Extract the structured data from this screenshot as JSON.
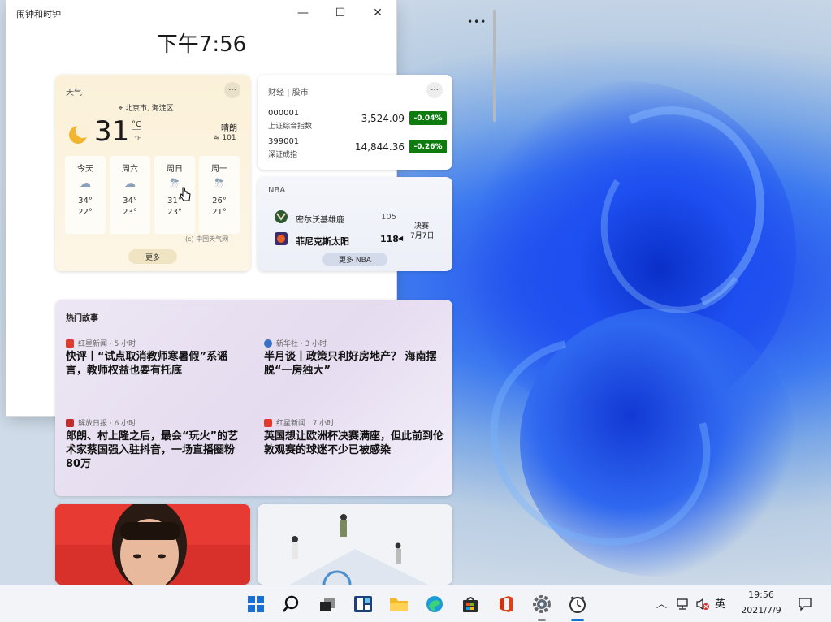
{
  "clock_window": {
    "title": "闹钟和时钟",
    "minimize": "—",
    "maximize": "☐",
    "close": "✕",
    "time": "下午7:56"
  },
  "desktop_more": "•••",
  "weather": {
    "title": "天气",
    "more_dots": "···",
    "location": "北京市, 海淀区",
    "temp": "31",
    "unit_c": "°C",
    "unit_f": "°F",
    "condition": "晴朗",
    "aqi": "101",
    "days": [
      {
        "name": "今天",
        "high": "34°",
        "low": "22°",
        "icon": "cloudy-icon"
      },
      {
        "name": "周六",
        "high": "34°",
        "low": "23°",
        "icon": "cloudy-icon"
      },
      {
        "name": "周日",
        "high": "31°",
        "low": "23°",
        "icon": "thunderstorm-icon"
      },
      {
        "name": "周一",
        "high": "26°",
        "low": "21°",
        "icon": "thunderstorm-icon"
      }
    ],
    "source": "(c) 中国天气网",
    "more": "更多"
  },
  "stocks": {
    "title": "财经 | 股市",
    "more_dots": "···",
    "rows": [
      {
        "code": "000001",
        "name": "上证综合指数",
        "value": "3,524.09",
        "change": "-0.04%"
      },
      {
        "code": "399001",
        "name": "深证成指",
        "value": "14,844.36",
        "change": "-0.26%"
      }
    ],
    "change_color": "#0f7b0f"
  },
  "nba": {
    "title": "NBA",
    "team1": "密尔沃基雄鹿",
    "score1": "105",
    "team2": "菲尼克斯太阳",
    "score2": "118",
    "stage": "决赛",
    "date": "7月7日",
    "more": "更多 NBA"
  },
  "news": {
    "title": "热门故事",
    "items": [
      {
        "source": "红星新闻 · 5 小时",
        "headline": "快评丨“试点取消教师寒暑假”系谣言，教师权益也要有托底",
        "src_color": "#e03a2f"
      },
      {
        "source": "新华社 · 3 小时",
        "headline": "半月谈丨政策只利好房地产？ 海南摆脱“一房独大”",
        "src_color": "#3a6fc4"
      },
      {
        "source": "解放日报 · 6 小时",
        "headline": "郎朗、村上隆之后，最会“玩火”的艺术家蔡国强入驻抖音，一场直播圈粉80万",
        "src_color": "#c42b2b"
      },
      {
        "source": "红星新闻 · 7 小时",
        "headline": "英国想让欧洲杯决赛满座，但此前到伦敦观赛的球迷不少已被感染",
        "src_color": "#e03a2f"
      }
    ]
  },
  "taskbar": {
    "time": "19:56",
    "date": "2021/7/9",
    "ime": "英",
    "icons": [
      "start-icon",
      "search-icon",
      "task-view-icon",
      "widgets-icon",
      "file-explorer-icon",
      "edge-icon",
      "store-icon",
      "office-icon",
      "settings-icon",
      "clock-app-icon"
    ]
  }
}
